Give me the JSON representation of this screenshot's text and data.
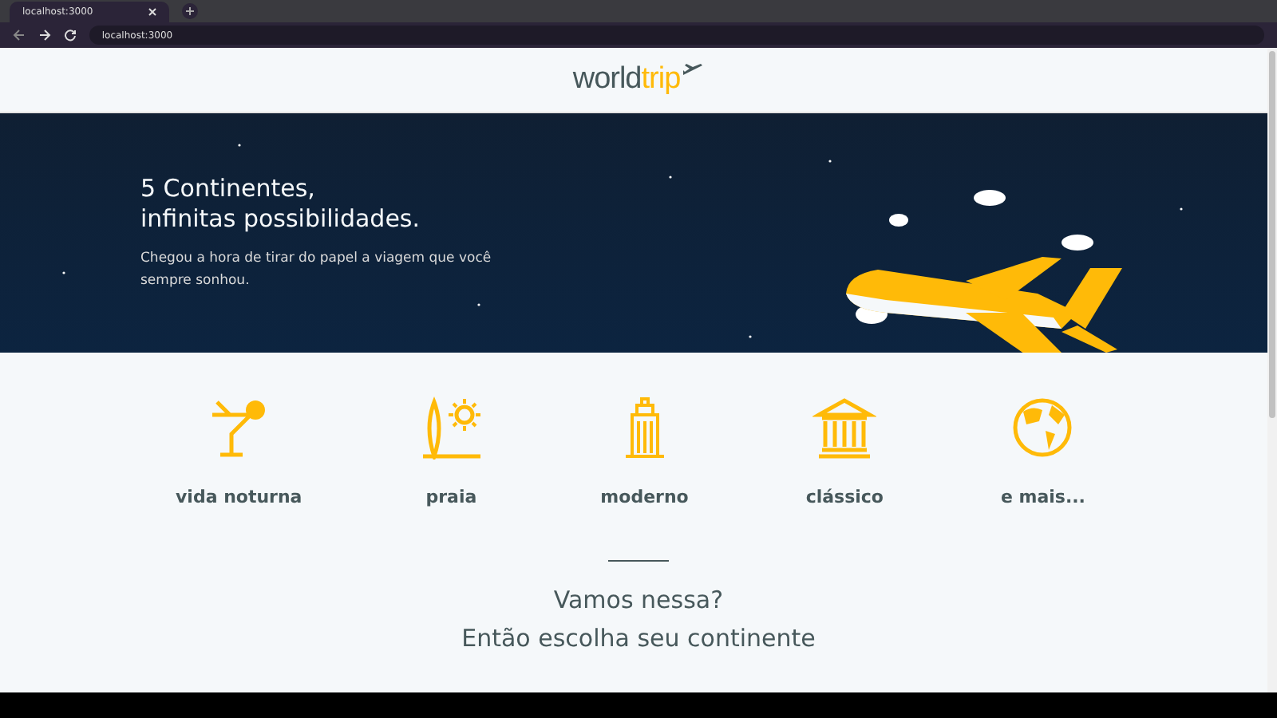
{
  "browser": {
    "tab_title": "localhost:3000",
    "url": "localhost:3000"
  },
  "logo": {
    "parts": [
      "world",
      "trip"
    ]
  },
  "banner": {
    "title_lines": [
      "5 Continentes,",
      "infinitas possibilidades."
    ],
    "subtitle": "Chegou a hora de tirar do papel a viagem que você sempre sonhou."
  },
  "categories": [
    {
      "label": "vida noturna",
      "kind": "cocktail"
    },
    {
      "label": "praia",
      "kind": "beach"
    },
    {
      "label": "moderno",
      "kind": "building"
    },
    {
      "label": "clássico",
      "kind": "temple"
    },
    {
      "label": "e mais...",
      "kind": "globe"
    }
  ],
  "call_to_action": [
    "Vamos nessa?",
    "Então escolha seu continente"
  ]
}
